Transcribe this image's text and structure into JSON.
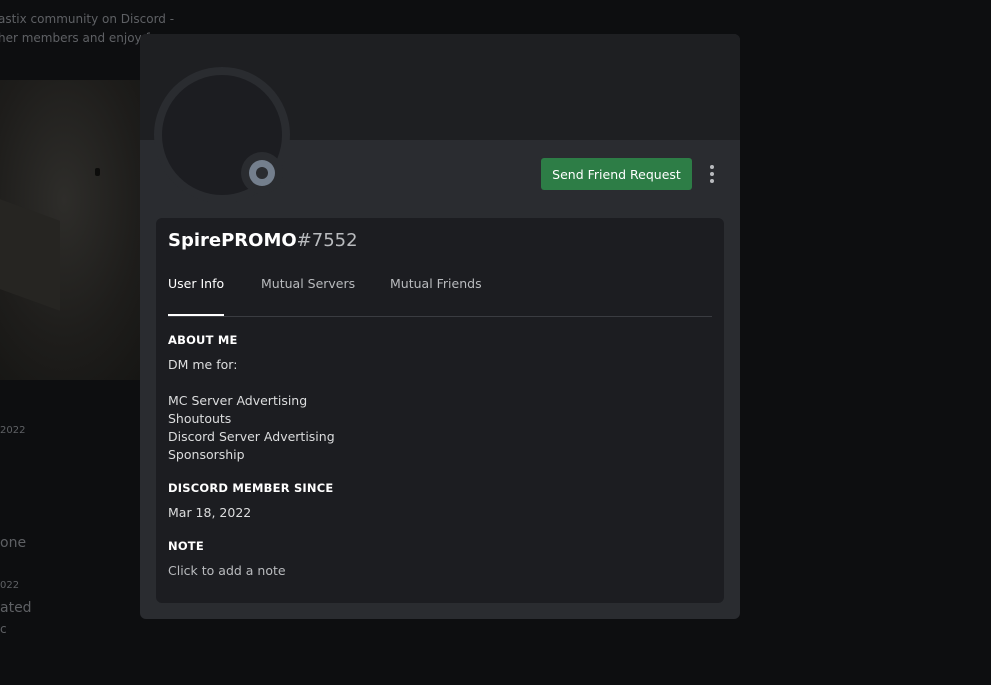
{
  "background": {
    "lines": [
      "astix community on Discord -",
      "her members and enjoy f",
      "2022",
      "one",
      "022",
      "ated",
      "c"
    ]
  },
  "modal": {
    "button_label": "Send Friend Request",
    "username": "SpirePROMO",
    "discriminator": "#7552",
    "tabs": [
      {
        "label": "User Info",
        "active": true
      },
      {
        "label": "Mutual Servers",
        "active": false
      },
      {
        "label": "Mutual Friends",
        "active": false
      }
    ],
    "about_me": {
      "title": "ABOUT ME",
      "lines": [
        "DM me for:",
        "MC Server Advertising",
        "Shoutouts",
        "Discord Server Advertising",
        "Sponsorship"
      ]
    },
    "member_since": {
      "title": "DISCORD MEMBER SINCE",
      "value": "Mar 18, 2022"
    },
    "note": {
      "title": "NOTE",
      "placeholder": "Click to add a note"
    },
    "status": "offline"
  },
  "colors": {
    "button": "#2d7d46",
    "modal": "#2a2c30",
    "card": "#1c1d21",
    "banner": "#1e1f22",
    "status_offline": "#747f8d"
  }
}
